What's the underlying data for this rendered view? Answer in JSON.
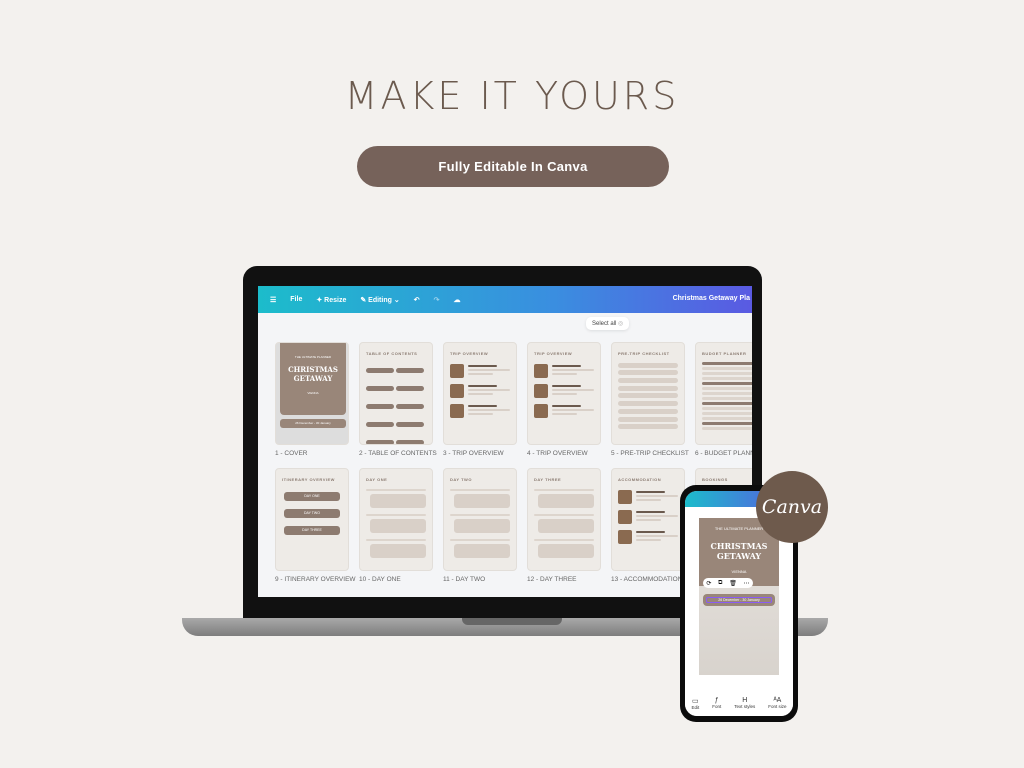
{
  "headline": "MAKE IT YOURS",
  "cta": "Fully Editable In Canva",
  "editor": {
    "toolbar": {
      "menu_icon": "hamburger-icon",
      "file": "File",
      "resize": "Resize",
      "editing": "Editing",
      "undo_icon": "undo-icon",
      "redo_icon": "redo-icon",
      "cloud_icon": "cloud-sync-icon",
      "doc_title": "Christmas Getaway Pla"
    },
    "select_all": "Select all",
    "pages": [
      {
        "header": "",
        "label": "1 - COVER"
      },
      {
        "header": "TABLE OF CONTENTS",
        "label": "2 - TABLE OF CONTENTS"
      },
      {
        "header": "TRIP OVERVIEW",
        "label": "3 - TRIP OVERVIEW"
      },
      {
        "header": "TRIP OVERVIEW",
        "label": "4 - TRIP OVERVIEW"
      },
      {
        "header": "PRE-TRIP CHECKLIST",
        "label": "5 - PRE-TRIP CHECKLIST"
      },
      {
        "header": "BUDGET PLANNER",
        "label": "6 - BUDGET PLANNER"
      },
      {
        "header": "ITINERARY OVERVIEW",
        "label": "9 - ITINERARY OVERVIEW"
      },
      {
        "header": "DAY ONE",
        "label": "10 - DAY ONE"
      },
      {
        "header": "DAY TWO",
        "label": "11 - DAY TWO"
      },
      {
        "header": "DAY THREE",
        "label": "12 - DAY THREE"
      },
      {
        "header": "ACCOMMODATION",
        "label": "13 - ACCOMMODATION"
      },
      {
        "header": "BOOKINGS",
        "label": ""
      }
    ],
    "itinerary_buttons": [
      "DAY ONE",
      "DAY TWO",
      "DAY THREE"
    ],
    "cover": {
      "kicker": "THE ULTIMATE PLANNER",
      "title": "CHRISTMAS GETAWAY",
      "place": "VIENNA",
      "dates": "26 December - 30 January"
    }
  },
  "phone": {
    "tools": [
      {
        "icon": "edit-icon",
        "label": "Edit"
      },
      {
        "icon": "font-icon",
        "label": "Font"
      },
      {
        "icon": "text-styles-icon",
        "label": "Text styles"
      },
      {
        "icon": "font-size-icon",
        "label": "Font size"
      }
    ]
  },
  "brand": "Canva",
  "colors": {
    "background": "#f3f1ee",
    "accent": "#76625a",
    "toolbar_start": "#1cbccb",
    "toolbar_end": "#5a5ae2"
  }
}
